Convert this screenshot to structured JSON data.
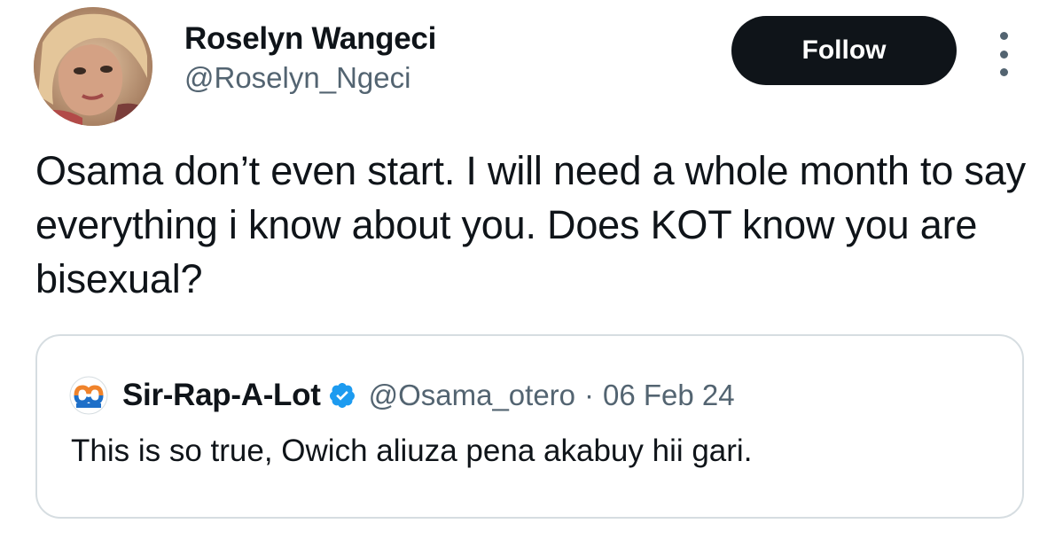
{
  "author": {
    "display_name": "Roselyn Wangeci",
    "handle": "@Roselyn_Ngeci"
  },
  "follow_button": {
    "label": "Follow"
  },
  "more_icon": "more-vertical-icon",
  "tweet": {
    "text": "Osama don’t even start. I will need a whole month to say everything i know about you. Does KOT know you are bisexual?"
  },
  "quoted_tweet": {
    "author_name": "Sir-Rap-A-Lot",
    "verified": true,
    "handle": "@Osama_otero",
    "separator": "·",
    "date": "06 Feb 24",
    "text": "This is so true, Owich aliuza pena akabuy hii gari."
  },
  "colors": {
    "text_primary": "#0f1419",
    "text_secondary": "#536471",
    "follow_bg": "#0f1419",
    "verified_blue": "#1d9bf0",
    "border": "#d6dde1"
  }
}
